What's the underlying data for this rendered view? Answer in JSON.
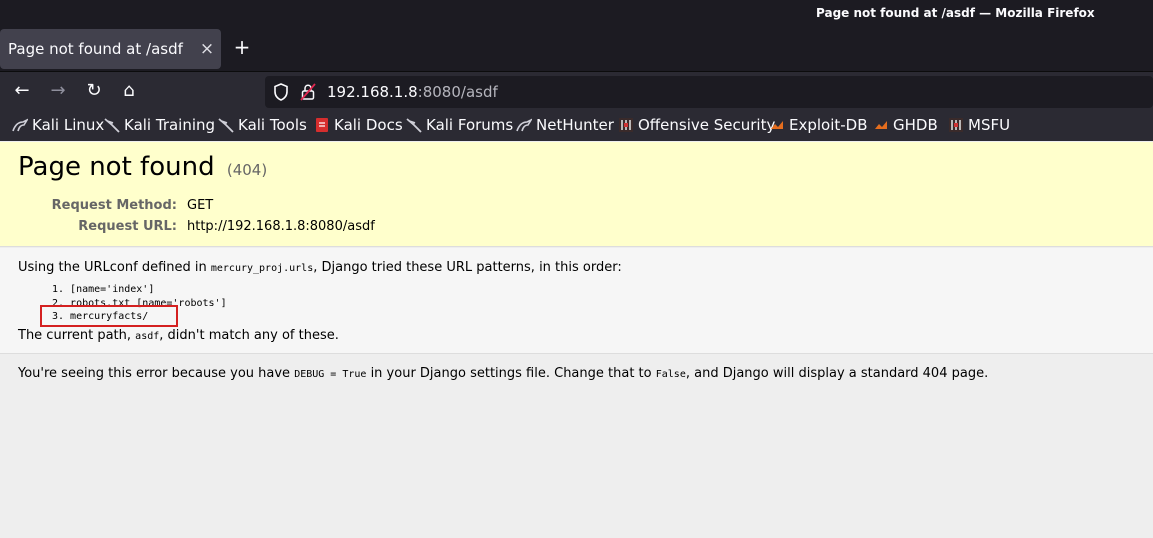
{
  "window": {
    "title": "Page not found at /asdf — Mozilla Firefox"
  },
  "tab": {
    "title": "Page not found at /asdf",
    "close": "×",
    "new_tab": "+"
  },
  "nav": {
    "back": "←",
    "forward": "→",
    "reload": "↻",
    "home": "⌂"
  },
  "url": {
    "host": "192.168.1.8",
    "rest": ":8080/asdf"
  },
  "bookmarks": [
    {
      "label": "Kali Linux",
      "icon": "kali-dragon-icon"
    },
    {
      "label": "Kali Training",
      "icon": "kali-dragon-icon"
    },
    {
      "label": "Kali Tools",
      "icon": "kali-dragon-icon"
    },
    {
      "label": "Kali Docs",
      "icon": "kali-docs-icon"
    },
    {
      "label": "Kali Forums",
      "icon": "kali-dragon-icon"
    },
    {
      "label": "NetHunter",
      "icon": "kali-dragon-icon"
    },
    {
      "label": "Offensive Security",
      "icon": "offsec-icon"
    },
    {
      "label": "Exploit-DB",
      "icon": "exploitdb-icon"
    },
    {
      "label": "GHDB",
      "icon": "exploitdb-icon"
    },
    {
      "label": "MSFU",
      "icon": "offsec-icon"
    }
  ],
  "summary": {
    "title": "Page not found",
    "code": "(404)",
    "request_method_label": "Request Method:",
    "request_method": "GET",
    "request_url_label": "Request URL:",
    "request_url": "http://192.168.1.8:8080/asdf"
  },
  "info": {
    "urlconf_prefix": "Using the URLconf defined in ",
    "urlconf_module": "mercury_proj.urls",
    "urlconf_suffix": ", Django tried these URL patterns, in this order:",
    "patterns": [
      "1. [name='index']",
      "2. robots.txt [name='robots']",
      "3. mercuryfacts/"
    ],
    "path_prefix": "The current path, ",
    "path_value": "asdf",
    "path_suffix": ", didn't match any of these."
  },
  "explanation": {
    "part1": "You're seeing this error because you have ",
    "debug_code": "DEBUG = True",
    "part2": " in your Django settings file. Change that to ",
    "false_code": "False",
    "part3": ", and Django will display a standard 404 page."
  },
  "colors": {
    "summary_bg": "#ffffcc",
    "highlight_box": "#d42020",
    "chrome_dark": "#1c1b22"
  }
}
